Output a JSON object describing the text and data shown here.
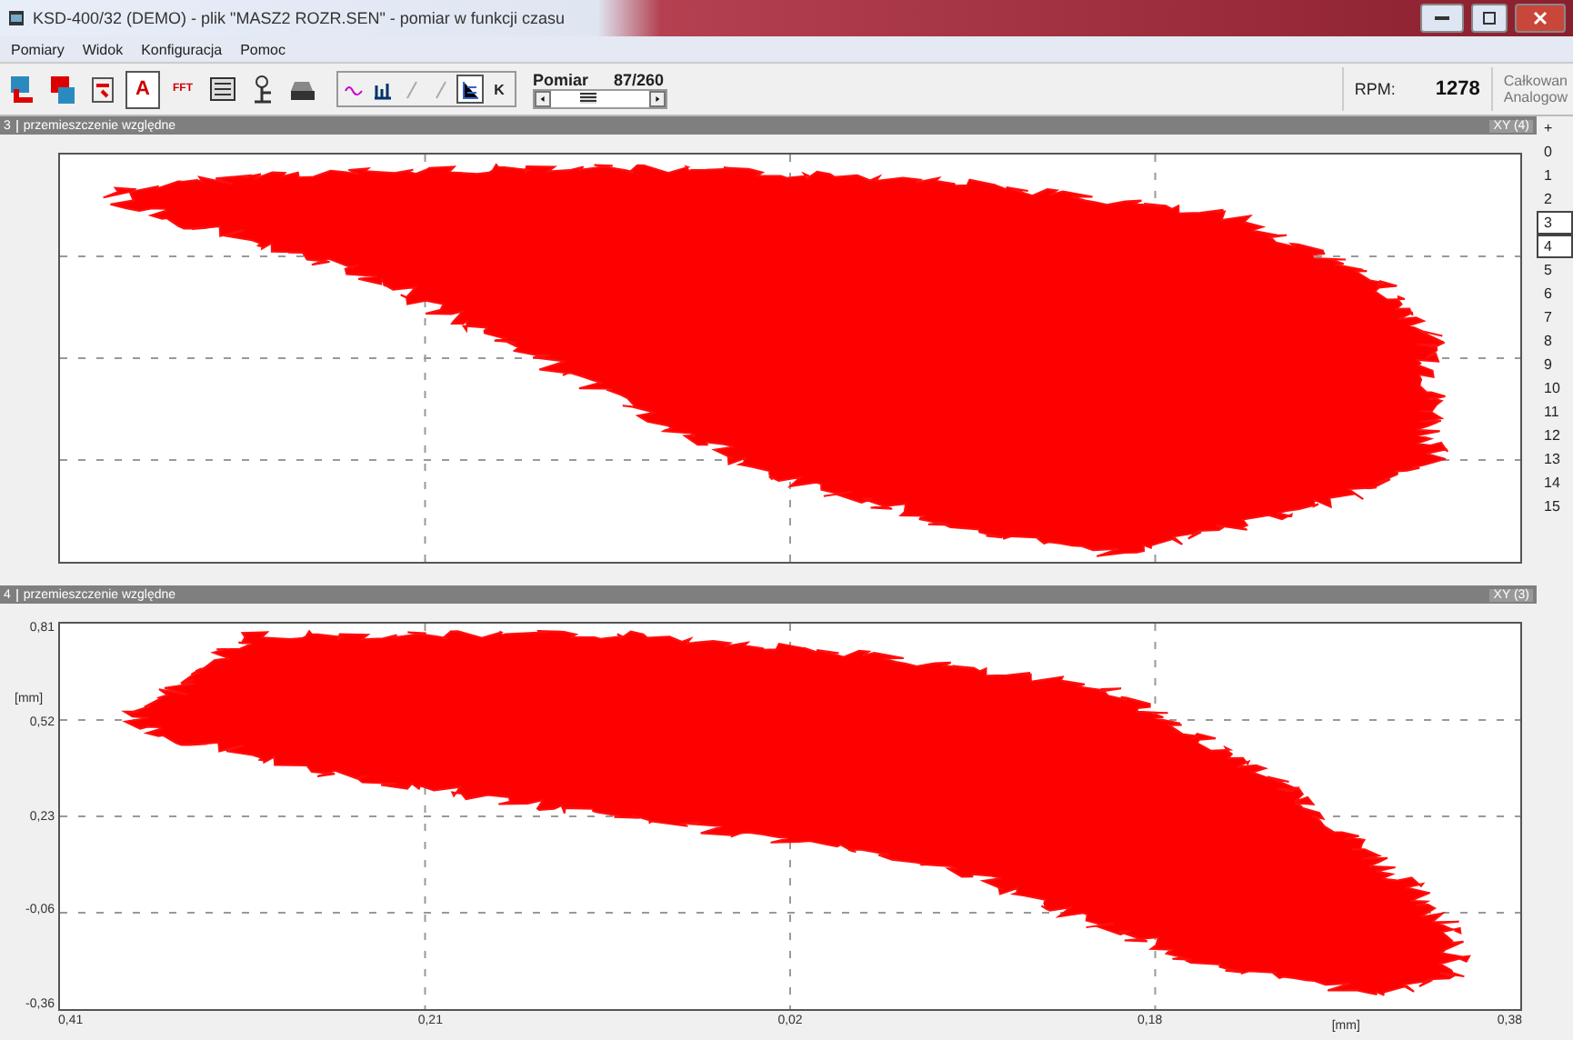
{
  "window": {
    "title": "KSD-400/32 (DEMO) - plik \"MASZ2 ROZR.SEN\" - pomiar w funkcji czasu"
  },
  "menu": [
    {
      "label": "Pomiary"
    },
    {
      "label": "Widok"
    },
    {
      "label": "Konfiguracja"
    },
    {
      "label": "Pomoc"
    }
  ],
  "toolbar": {
    "tools": [
      {
        "kind": "open"
      },
      {
        "kind": "save"
      },
      {
        "kind": "range"
      },
      {
        "kind": "letter",
        "label": "A",
        "selected": true
      },
      {
        "kind": "letter",
        "label": "FFT",
        "selected": false
      },
      {
        "kind": "screen"
      },
      {
        "kind": "scale"
      },
      {
        "kind": "print"
      }
    ],
    "view_tools": [
      {
        "kind": "wave",
        "selected": false
      },
      {
        "kind": "bars",
        "selected": false
      },
      {
        "kind": "slash",
        "selected": false
      },
      {
        "kind": "slash",
        "selected": false
      },
      {
        "kind": "lines",
        "selected": true
      },
      {
        "kind": "letter",
        "label": "K",
        "selected": false
      }
    ],
    "measurement": {
      "label": "Pomiar",
      "value": "87/260"
    },
    "rpm": {
      "label": "RPM:",
      "value": "1278"
    },
    "mode": [
      "Całkowan",
      "Analogow"
    ]
  },
  "panels": [
    {
      "number": "3",
      "title": "przemieszczenie względne",
      "mode": "XY (4)"
    },
    {
      "number": "4",
      "title": "przemieszczenie względne",
      "mode": "XY (3)",
      "x_unit": "[mm]",
      "y_unit": "[mm]",
      "x_ticks": [
        "0,41",
        "0,21",
        "0,02",
        "0,18",
        "0,38"
      ],
      "y_ticks": [
        "0,81",
        "0,52",
        "0,23",
        "-0,06",
        "-0,36"
      ]
    }
  ],
  "channels": [
    {
      "label": "+",
      "selected": false
    },
    {
      "label": "0",
      "selected": false
    },
    {
      "label": "1",
      "selected": false
    },
    {
      "label": "2",
      "selected": false
    },
    {
      "label": "3",
      "selected": true
    },
    {
      "label": "4",
      "selected": true
    },
    {
      "label": "5",
      "selected": false
    },
    {
      "label": "6",
      "selected": false
    },
    {
      "label": "7",
      "selected": false
    },
    {
      "label": "8",
      "selected": false
    },
    {
      "label": "9",
      "selected": false
    },
    {
      "label": "10",
      "selected": false
    },
    {
      "label": "11",
      "selected": false
    },
    {
      "label": "12",
      "selected": false
    },
    {
      "label": "13",
      "selected": false
    },
    {
      "label": "14",
      "selected": false
    },
    {
      "label": "15",
      "selected": false
    }
  ]
}
